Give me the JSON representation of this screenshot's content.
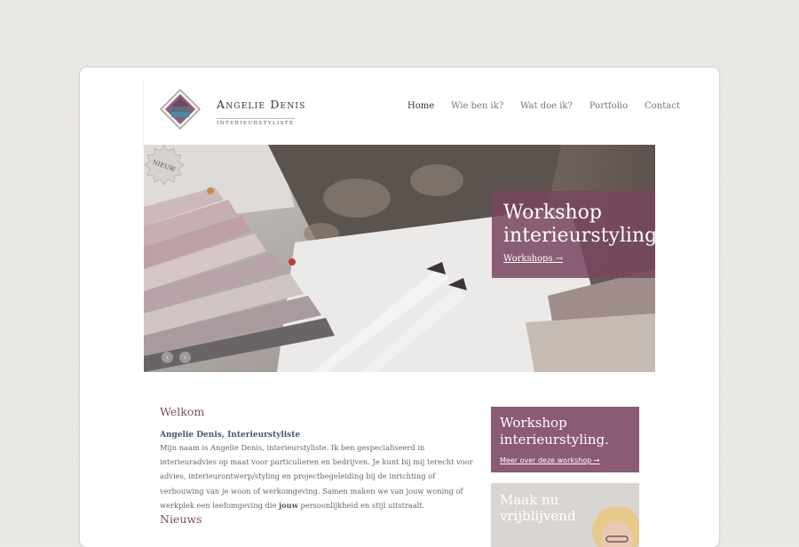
{
  "brand": {
    "name": "Angelie Denis",
    "subtitle": "Interieurstyliste"
  },
  "nav": [
    {
      "label": "Home",
      "active": true
    },
    {
      "label": "Wie ben ik?"
    },
    {
      "label": "Wat doe ik?"
    },
    {
      "label": "Portfolio"
    },
    {
      "label": "Contact"
    }
  ],
  "hero": {
    "promo_title_line1": "Workshop",
    "promo_title_line2": "interieurstyling.",
    "promo_link": "Workshops →",
    "badge": "NIEUW",
    "slider_prev": "‹",
    "slider_next": "›"
  },
  "welcome": {
    "heading": "Welkom",
    "subtitle": "Angelie Denis, Interieurstyliste",
    "text_before": "Mijn naam is Angelie Denis, interieurstyliste. Ik ben gespecialiseerd in interieuradvies op maat voor particulieren en bedrijven. Je kunt bij mij terecht voor advies, interieurontwerp/styling en projectbegeleiding bij de inrichting of verbouwing van je woon of werkomgeving. Samen maken we van jouw woning of werkplek een leefomgeving die ",
    "text_bold": "jouw",
    "text_after": " persoonlijkheid en stijl uitstraalt."
  },
  "news": {
    "heading": "Nieuws"
  },
  "sidebar": {
    "promo_line1": "Workshop",
    "promo_line2": "interieurstyling.",
    "promo_link": "Meer over deze workshop →",
    "contact_line1": "Maak nu",
    "contact_line2": "vrijblijvend"
  },
  "colors": {
    "accent": "#7b4a63",
    "promo": "#8b5a74",
    "link_blue": "#3c5a74"
  }
}
